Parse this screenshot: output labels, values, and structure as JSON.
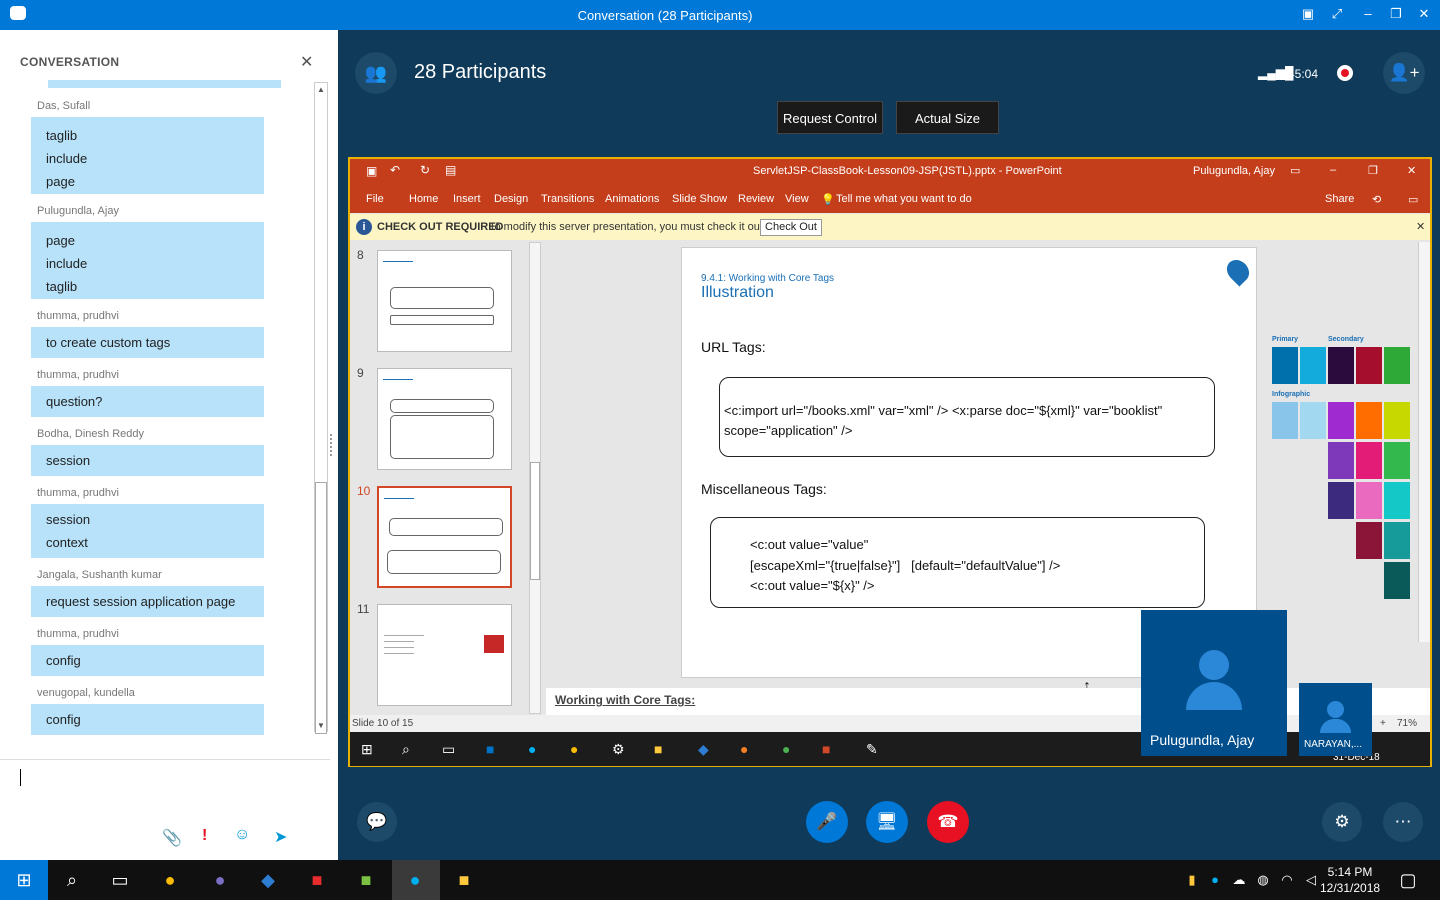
{
  "window": {
    "title": "Conversation (28 Participants)"
  },
  "conversation": {
    "header": "CONVERSATION",
    "messages": [
      {
        "sender": "Das, Sufall",
        "lines": [
          "taglib",
          "include",
          "page"
        ]
      },
      {
        "sender": "Pulugundla, Ajay",
        "lines": [
          "page",
          "include",
          "taglib"
        ]
      },
      {
        "sender": "thumma, prudhvi",
        "lines": [
          "to create custom tags"
        ]
      },
      {
        "sender": "thumma, prudhvi",
        "lines": [
          "question?"
        ]
      },
      {
        "sender": "Bodha, Dinesh Reddy",
        "lines": [
          "session"
        ]
      },
      {
        "sender": "thumma, prudhvi",
        "lines": [
          "session",
          "context"
        ]
      },
      {
        "sender": "Jangala, Sushanth kumar",
        "lines": [
          "request session application page"
        ]
      },
      {
        "sender": "thumma, prudhvi",
        "lines": [
          "config"
        ]
      },
      {
        "sender": "venugopal, kundella",
        "lines": [
          "config"
        ]
      }
    ]
  },
  "meeting": {
    "participants_label": "28 Participants",
    "timer": "45:04",
    "request_control": "Request Control",
    "actual_size": "Actual Size"
  },
  "powerpoint": {
    "file_title": "ServletJSP-ClassBook-Lesson09-JSP(JSTL).pptx  -  PowerPoint",
    "user": "Pulugundla, Ajay",
    "menu": [
      "File",
      "Home",
      "Insert",
      "Design",
      "Transitions",
      "Animations",
      "Slide Show",
      "Review",
      "View"
    ],
    "tell_me": "Tell me what you want to do",
    "share": "Share",
    "checkout_bold": "CHECK OUT REQUIRED",
    "checkout_msg": "To modify this server presentation, you must check it out.",
    "checkout_btn": "Check Out",
    "thumb_numbers": [
      "8",
      "9",
      "10",
      "11"
    ],
    "slide": {
      "subtitle": "9.4.1: Working with Core Tags",
      "title": "Illustration",
      "url_heading": "URL Tags:",
      "url_code": "<c:import url=\"/books.xml\" var=\"xml\" /> <x:parse doc=\"${xml}\" var=\"booklist\"   scope=\"application\" />",
      "misc_heading": "Miscellaneous  Tags:",
      "misc_code": "<c:out value=\"value\"\n[escapeXml=\"{true|false}\"]   [default=\"defaultValue\"] />\n<c:out value=\"${x}\" />"
    },
    "notes": "Working with Core Tags:",
    "status_slide": "Slide 10 of 15",
    "zoom": "71%",
    "palette": {
      "primary": "Primary",
      "secondary": "Secondary",
      "infographic": "Infographic"
    }
  },
  "video": {
    "main_name": "Pulugundla, Ajay",
    "small_name": "NARAYAN,..."
  },
  "inner_clock_date": "31-Dec-18",
  "taskbar": {
    "time": "5:14 PM",
    "date": "12/31/2018"
  },
  "colors": {
    "accent": "#0078d7",
    "stage": "#0f3a59",
    "bubble": "#b7e2f9",
    "ppt": "#c43e1c",
    "hangup": "#e81123"
  }
}
